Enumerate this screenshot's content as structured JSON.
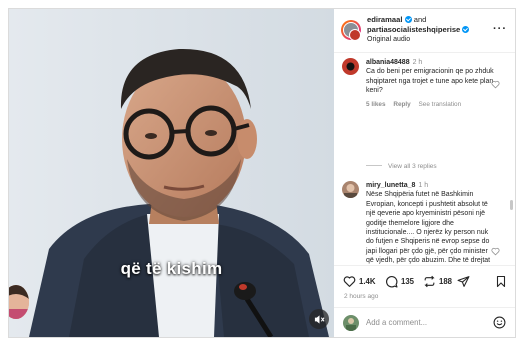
{
  "video": {
    "caption": "që të kishim",
    "mute_icon": "speaker-muted-icon"
  },
  "post_header": {
    "author_primary": "ediramaal",
    "and_text": "and",
    "author_secondary": "partiasocialisteshqiperise",
    "audio_label": "Original audio",
    "more_icon": "more-horizontal-icon"
  },
  "comments": [
    {
      "user": "albania48488",
      "time": "2 h",
      "text": "Ca do beni per emigracionin qe po zhduk shqiptaret nga trojet e tune apo kete plan keni?",
      "likes": "5 likes",
      "reply": "Reply",
      "translation": "See translation"
    },
    {
      "user": "miry_lunetta_8",
      "time": "1 h",
      "text": "Nëse Shqipëria futet në Bashkimin Evropian, koncepti i pushtetit absolut të një qeverie apo kryeministri pësoni një goditje themelore ligjore dhe institucionale.... O njerëz ky person nuk do futjen e Shqiperis në evrop sepse do japi llogari për çdo gjë, për çdo minister që vjedh, për çdo abuzim. Dhe të drejtat e njeriut osé shkeljet e ligjit në Shqipëri ndahen në gjykaten evropiane... Po'"
    }
  ],
  "view_replies": "View all 3 replies",
  "actions": {
    "likes": "1.4K",
    "comments": "135",
    "shares": "188"
  },
  "posted_time": "2 hours ago",
  "add_comment_placeholder": "Add a comment...",
  "colors": {
    "verified": "#0095f6",
    "text": "#262626",
    "muted": "#8e8e8e",
    "border": "#dbdbdb"
  }
}
